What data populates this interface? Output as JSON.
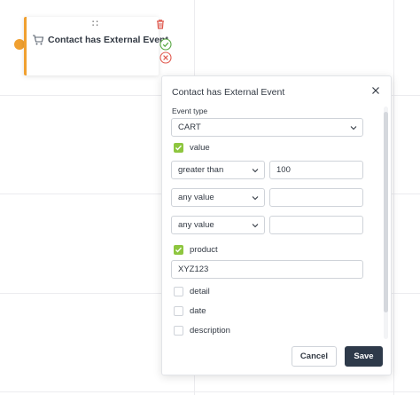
{
  "node": {
    "title": "Contact has External Event",
    "drag_glyph": "∷",
    "accent_color": "#f0a030"
  },
  "panel": {
    "title": "Contact has External Event",
    "event_type_label": "Event type",
    "event_type_value": "CART",
    "value_checkbox_label": "value",
    "conditions": [
      {
        "operator": "greater than",
        "value": "100"
      },
      {
        "operator": "any value",
        "value": ""
      },
      {
        "operator": "any value",
        "value": ""
      }
    ],
    "product_checkbox_label": "product",
    "product_value": "XYZ123",
    "unchecked_fields": [
      "detail",
      "date",
      "description"
    ],
    "cancel_label": "Cancel",
    "save_label": "Save"
  },
  "colors": {
    "check_green": "#8ec63f",
    "save_dark": "#2e3a4a",
    "delete_red": "#e05a4f",
    "success_green": "#5aa845"
  }
}
